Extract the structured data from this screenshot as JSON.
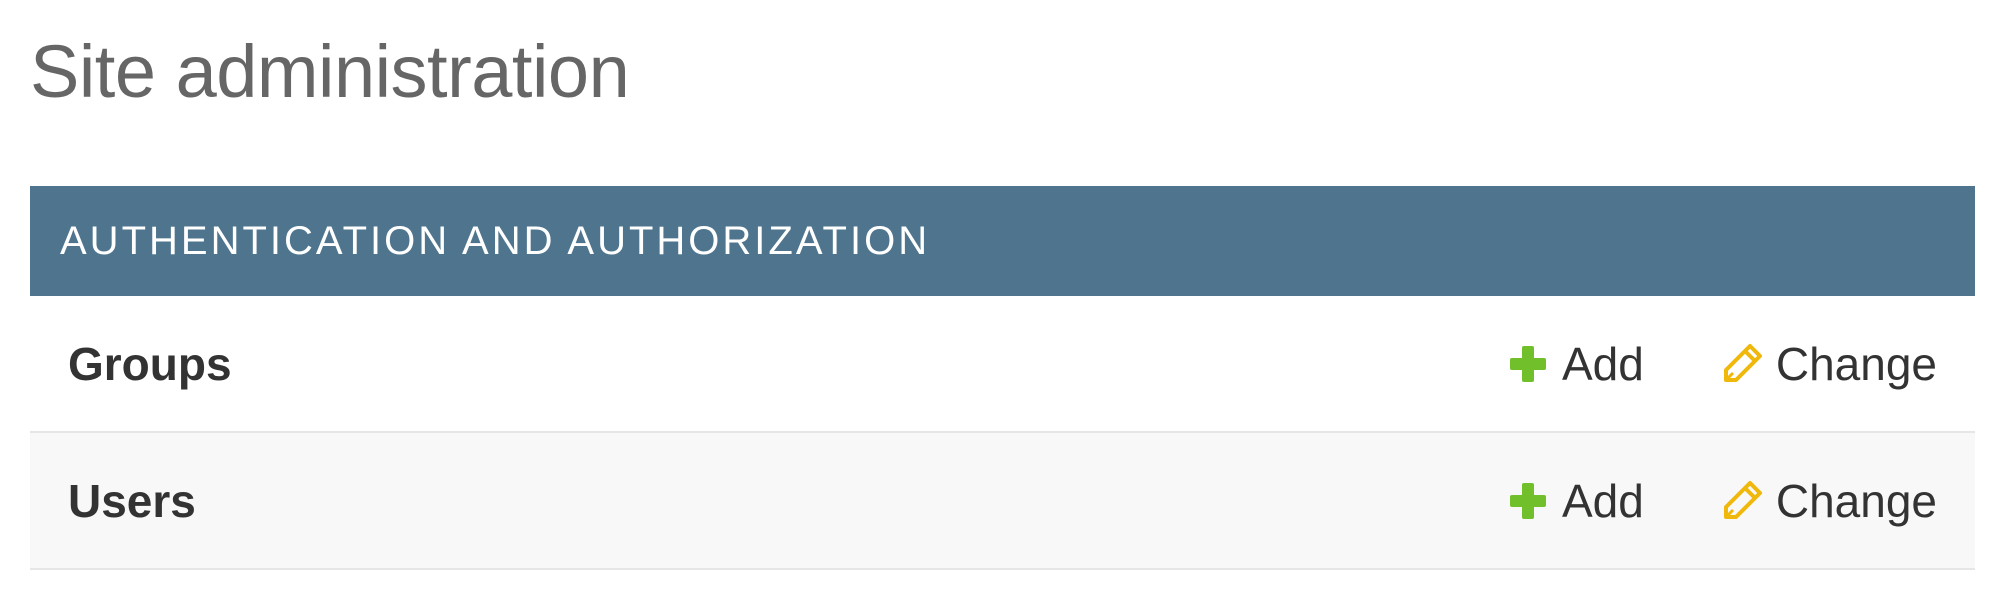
{
  "page": {
    "title": "Site administration"
  },
  "module": {
    "caption": "AUTHENTICATION AND AUTHORIZATION",
    "caption_color": "#4f758e",
    "rows": [
      {
        "name": "Groups",
        "add_label": "Add",
        "change_label": "Change"
      },
      {
        "name": "Users",
        "add_label": "Add",
        "change_label": "Change"
      }
    ]
  },
  "icons": {
    "add": "plus-icon",
    "change": "pencil-icon",
    "add_color": "#70bf2b",
    "change_color": "#efb80b"
  }
}
